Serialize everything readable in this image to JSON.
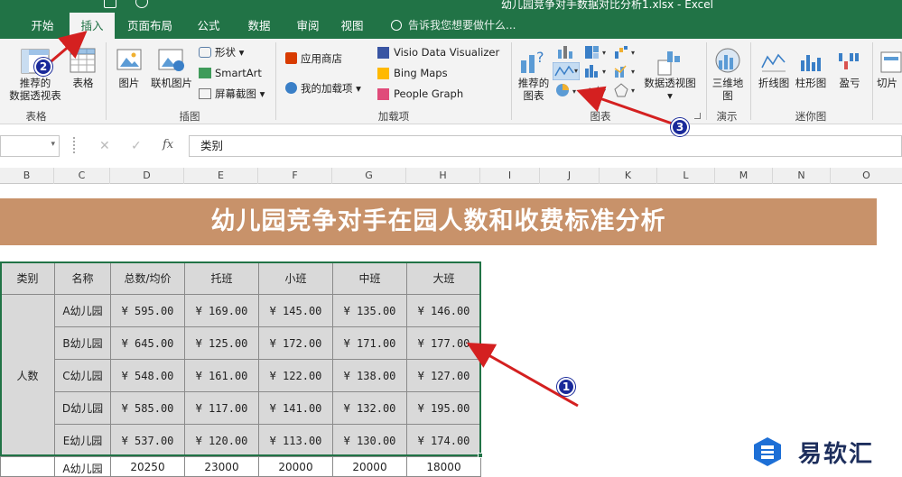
{
  "window": {
    "title": "幼儿园竞争对手数据对比分析1.xlsx - Excel"
  },
  "tabs": [
    {
      "label": "开始"
    },
    {
      "label": "插入"
    },
    {
      "label": "页面布局"
    },
    {
      "label": "公式"
    },
    {
      "label": "数据"
    },
    {
      "label": "审阅"
    },
    {
      "label": "视图"
    }
  ],
  "tell_me": "告诉我您想要做什么...",
  "ribbon": {
    "tables": {
      "pivot_label": "推荐的\n数据透视表",
      "table_label": "表格",
      "group": "表格"
    },
    "illustrations": {
      "picture": "图片",
      "online_picture": "联机图片",
      "shapes": "形状",
      "smartart": "SmartArt",
      "screenshot": "屏幕截图",
      "group": "插图"
    },
    "addins": {
      "store": "应用商店",
      "my_addins": "我的加载项",
      "visio": "Visio Data Visualizer",
      "bing": "Bing Maps",
      "people": "People Graph",
      "group": "加载项"
    },
    "charts": {
      "recommended": "推荐的\n图表",
      "pivot_chart": "数据透视图",
      "group": "图表"
    },
    "tours": {
      "map3d": "三维地\n图",
      "group": "演示"
    },
    "sparklines": {
      "line": "折线图",
      "column": "柱形图",
      "winloss": "盈亏",
      "group": "迷你图"
    },
    "filters": {
      "slicer": "切片"
    }
  },
  "formula_bar": {
    "fx": "fx",
    "content": "类别"
  },
  "columns": [
    "B",
    "C",
    "D",
    "E",
    "F",
    "G",
    "H",
    "I",
    "J",
    "K",
    "L",
    "M",
    "N",
    "O"
  ],
  "sheet": {
    "banner": "幼儿园竞争对手在园人数和收费标准分析",
    "headers": [
      "类别",
      "名称",
      "总数/均价",
      "托班",
      "小班",
      "中班",
      "大班"
    ],
    "category": "人数",
    "rows": [
      {
        "name": "A幼儿园",
        "total": "¥  595.00",
        "tuo": "¥  169.00",
        "xiao": "¥  145.00",
        "zhong": "¥  135.00",
        "da": "¥  146.00"
      },
      {
        "name": "B幼儿园",
        "total": "¥  645.00",
        "tuo": "¥  125.00",
        "xiao": "¥  172.00",
        "zhong": "¥  171.00",
        "da": "¥  177.00"
      },
      {
        "name": "C幼儿园",
        "total": "¥  548.00",
        "tuo": "¥  161.00",
        "xiao": "¥  122.00",
        "zhong": "¥  138.00",
        "da": "¥  127.00"
      },
      {
        "name": "D幼儿园",
        "total": "¥  585.00",
        "tuo": "¥  117.00",
        "xiao": "¥  141.00",
        "zhong": "¥  132.00",
        "da": "¥  195.00"
      },
      {
        "name": "E幼儿园",
        "total": "¥  537.00",
        "tuo": "¥  120.00",
        "xiao": "¥  113.00",
        "zhong": "¥  130.00",
        "da": "¥  174.00"
      }
    ],
    "partial_row": {
      "name": "A幼儿园",
      "total": "20250",
      "tuo": "23000",
      "xiao": "20000",
      "zhong": "20000",
      "da": "18000"
    }
  },
  "annotations": {
    "b1": "1",
    "b2": "2",
    "b3": "3"
  },
  "watermark": {
    "text": "易软汇"
  },
  "colors": {
    "excel_green": "#217346",
    "banner": "#c8926a",
    "badge": "#1a2a9a",
    "arrow": "#d42020"
  }
}
